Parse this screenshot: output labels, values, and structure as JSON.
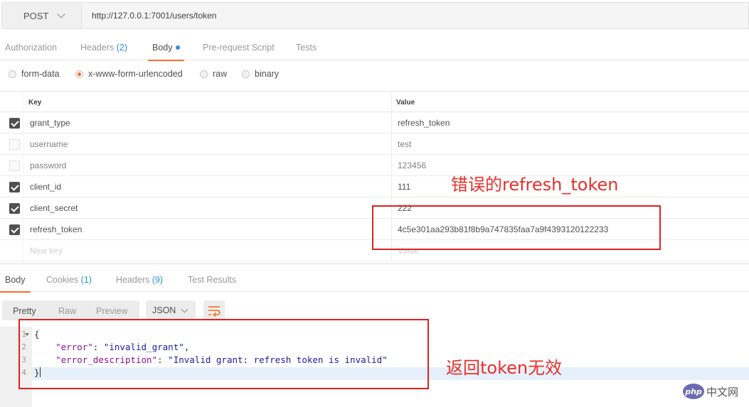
{
  "request": {
    "method": "POST",
    "url": "http://127.0.0.1:7001/users/token"
  },
  "request_tabs": [
    {
      "label": "Authorization"
    },
    {
      "label": "Headers",
      "count": "(2)"
    },
    {
      "label": "Body"
    },
    {
      "label": "Pre-request Script"
    },
    {
      "label": "Tests"
    }
  ],
  "body_types": [
    {
      "label": "form-data"
    },
    {
      "label": "x-www-form-urlencoded"
    },
    {
      "label": "raw"
    },
    {
      "label": "binary"
    }
  ],
  "kv_table": {
    "key_header": "Key",
    "value_header": "Value",
    "rows": [
      {
        "key": "grant_type",
        "value": "refresh_token"
      },
      {
        "key": "username",
        "value": "test"
      },
      {
        "key": "password",
        "value": "123456"
      },
      {
        "key": "client_id",
        "value": "111"
      },
      {
        "key": "client_secret",
        "value": "222"
      },
      {
        "key": "refresh_token",
        "value": "4c5e301aa293b81f8b9a747835faa7a9f4393120122233"
      }
    ],
    "new_key_placeholder": "New key",
    "new_value_placeholder": "Value"
  },
  "response_tabs": [
    {
      "label": "Body"
    },
    {
      "label": "Cookies",
      "count": "(1)"
    },
    {
      "label": "Headers",
      "count": "(9)"
    },
    {
      "label": "Test Results"
    }
  ],
  "response_view": {
    "modes": [
      "Pretty",
      "Raw",
      "Preview"
    ],
    "format": "JSON"
  },
  "response_code": {
    "line_numbers": [
      "1",
      "2",
      "3",
      "4"
    ],
    "open_brace": "{",
    "close_brace": "}",
    "error_key": "\"error\"",
    "error_value": "\"invalid_grant\"",
    "desc_key": "\"error_description\"",
    "desc_value": "\"Invalid grant: refresh token is invalid\""
  },
  "annotations": {
    "wrong_token_note": "错误的refresh_token",
    "invalid_token_note": "返回token无效"
  },
  "watermark": {
    "badge": "php",
    "text": "中文网"
  },
  "colors": {
    "accent": "#f47023",
    "link": "#2f8fd8",
    "annotation_red": "#e02020"
  }
}
